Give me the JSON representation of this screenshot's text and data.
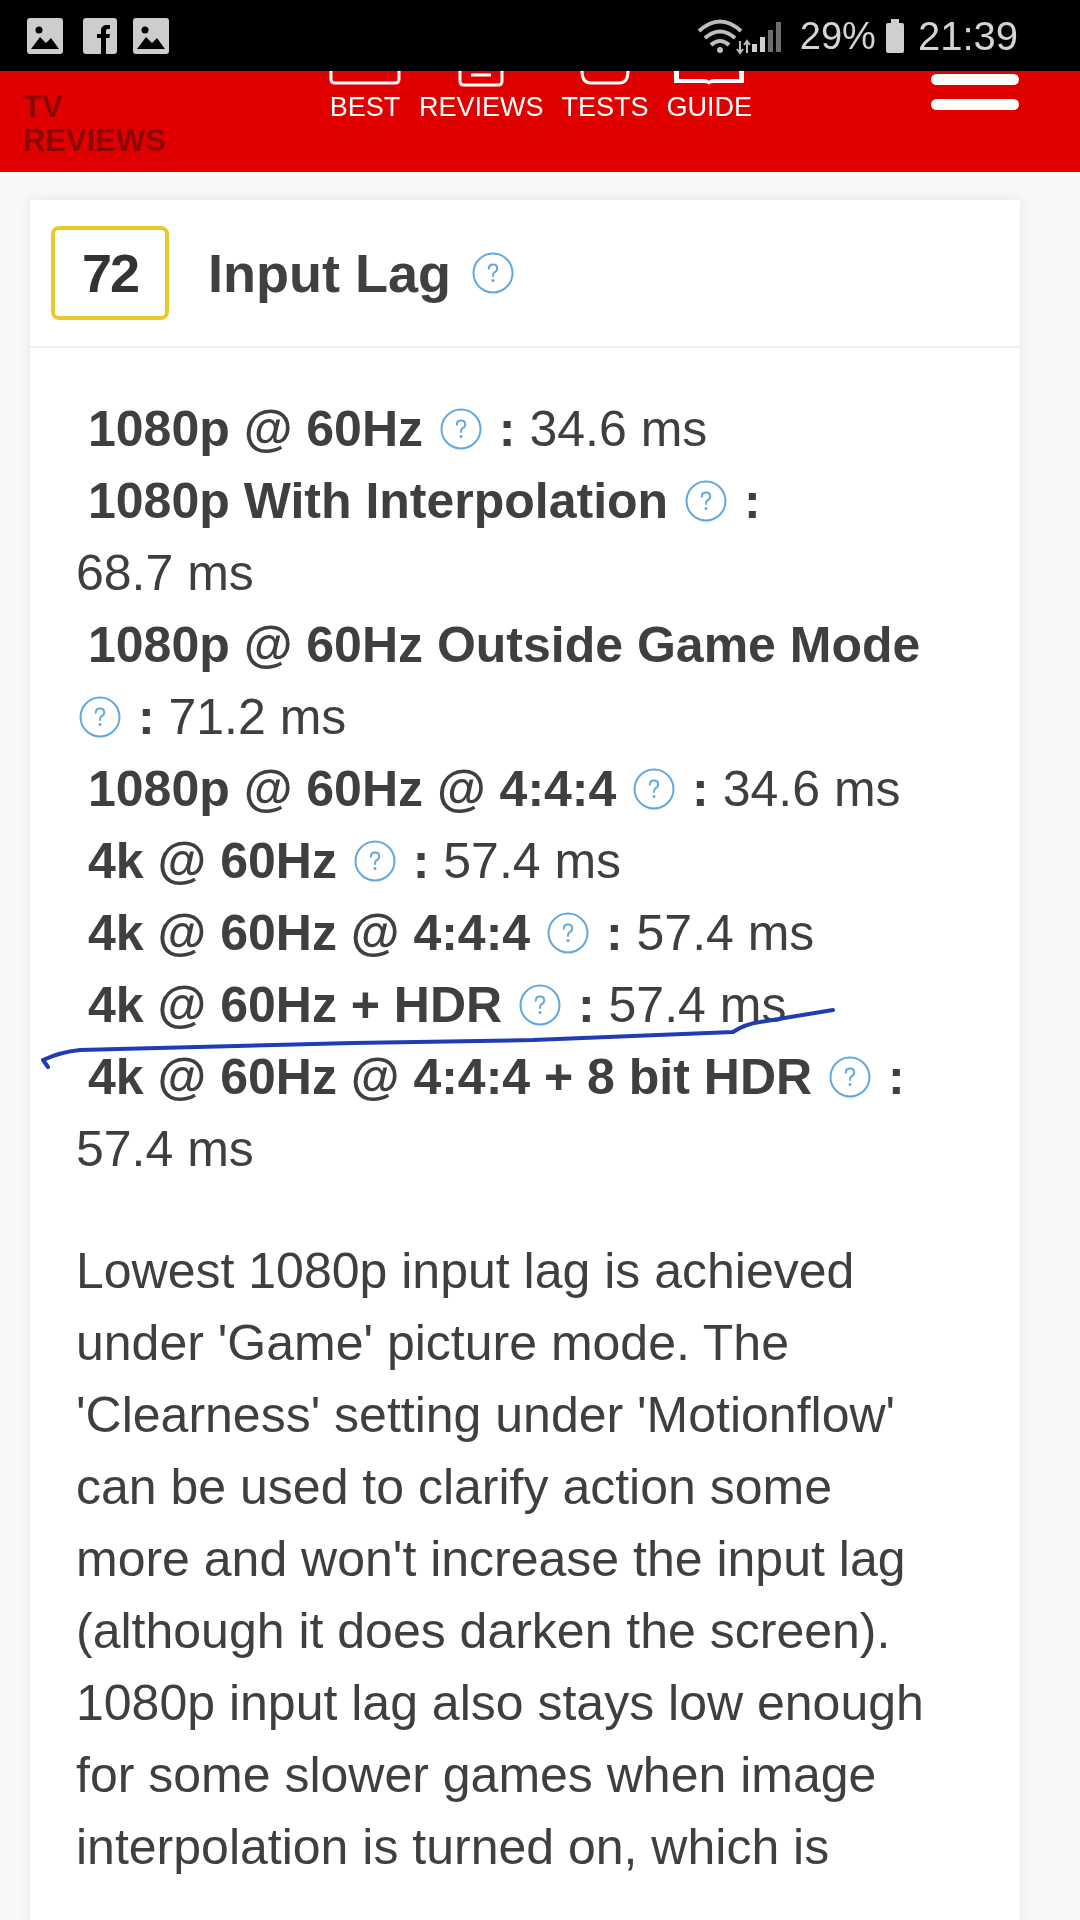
{
  "status_bar": {
    "battery": "29%",
    "time": "21:39"
  },
  "header": {
    "logo": "TV REVIEWS",
    "nav": [
      {
        "label": "BEST"
      },
      {
        "label": "REVIEWS"
      },
      {
        "label": "TESTS"
      },
      {
        "label": "GUIDE"
      }
    ]
  },
  "section": {
    "score": "72",
    "title": "Input Lag",
    "measurements": [
      {
        "label": "1080p @ 60Hz",
        "separator": ":",
        "value": "34.6 ms"
      },
      {
        "label": "1080p With Interpolation",
        "separator": ":",
        "value": "68.7 ms"
      },
      {
        "label": "1080p @ 60Hz Outside Game Mode",
        "separator": ":",
        "value": "71.2 ms"
      },
      {
        "label": "1080p @ 60Hz @ 4:4:4",
        "separator": ":",
        "value": "34.6 ms"
      },
      {
        "label": "4k @ 60Hz",
        "separator": ":",
        "value": "57.4 ms"
      },
      {
        "label": "4k @ 60Hz @ 4:4:4",
        "separator": ":",
        "value": "57.4 ms"
      },
      {
        "label": "4k @ 60Hz + HDR",
        "separator": ":",
        "value": "57.4 ms"
      },
      {
        "label": "4k @ 60Hz @ 4:4:4 + 8 bit HDR",
        "separator": ":",
        "value": "57.4 ms"
      }
    ],
    "description": "Lowest 1080p input lag is achieved under 'Game' picture mode. The 'Clearness' setting under 'Motionflow' can be used to clarify action some more and won't increase the input lag (although it does darken the screen). 1080p input lag also stays low enough for some slower games when image interpolation is turned on, which is"
  }
}
